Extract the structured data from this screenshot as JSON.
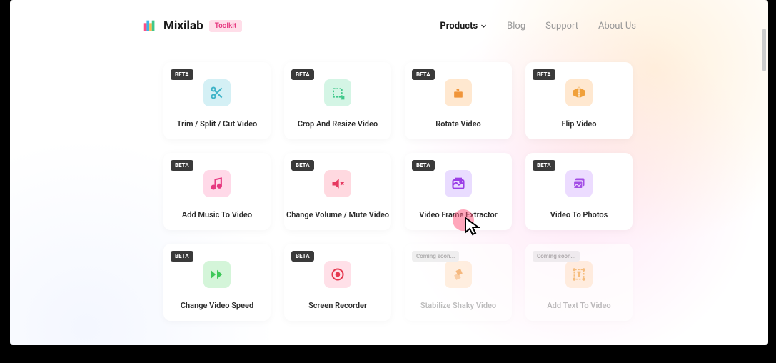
{
  "brand": {
    "name": "Mixilab",
    "badge": "Toolkit"
  },
  "nav": {
    "products": "Products",
    "blog": "Blog",
    "support": "Support",
    "about": "About Us"
  },
  "badges": {
    "beta": "BETA",
    "coming_soon": "Coming soon..."
  },
  "tools": [
    {
      "label": "Trim / Split / Cut Video",
      "status": "beta",
      "icon": "scissors-icon",
      "color": "#3fb4c8",
      "bg": "icon-bg-blue"
    },
    {
      "label": "Crop And Resize Video",
      "status": "beta",
      "icon": "crop-icon",
      "color": "#3fc88a",
      "bg": "icon-bg-mint"
    },
    {
      "label": "Rotate Video",
      "status": "beta",
      "icon": "rotate-icon",
      "color": "#f0953a",
      "bg": "icon-bg-orange"
    },
    {
      "label": "Flip Video",
      "status": "beta",
      "icon": "flip-icon",
      "color": "#f0a03a",
      "bg": "icon-bg-lightorange"
    },
    {
      "label": "Add Music To Video",
      "status": "beta",
      "icon": "music-icon",
      "color": "#e63980",
      "bg": "icon-bg-pink"
    },
    {
      "label": "Change Volume / Mute Video",
      "status": "beta",
      "icon": "mute-icon",
      "color": "#e63960",
      "bg": "icon-bg-pinkred"
    },
    {
      "label": "Video Frame Extractor",
      "status": "beta",
      "icon": "frame-icon",
      "color": "#9b3ee6",
      "bg": "icon-bg-purple"
    },
    {
      "label": "Video To Photos",
      "status": "beta",
      "icon": "photos-icon",
      "color": "#a34ee6",
      "bg": "icon-bg-lavender"
    },
    {
      "label": "Change Video Speed",
      "status": "beta",
      "icon": "speed-icon",
      "color": "#3fc85a",
      "bg": "icon-bg-green"
    },
    {
      "label": "Screen Recorder",
      "status": "beta",
      "icon": "record-icon",
      "color": "#e63950",
      "bg": "icon-bg-redpink"
    },
    {
      "label": "Stabilize Shaky Video",
      "status": "coming_soon",
      "icon": "stabilize-icon",
      "color": "#f0953a",
      "bg": "icon-bg-orange"
    },
    {
      "label": "Add Text To Video",
      "status": "coming_soon",
      "icon": "text-icon",
      "color": "#f0a03a",
      "bg": "icon-bg-lightorange"
    }
  ]
}
